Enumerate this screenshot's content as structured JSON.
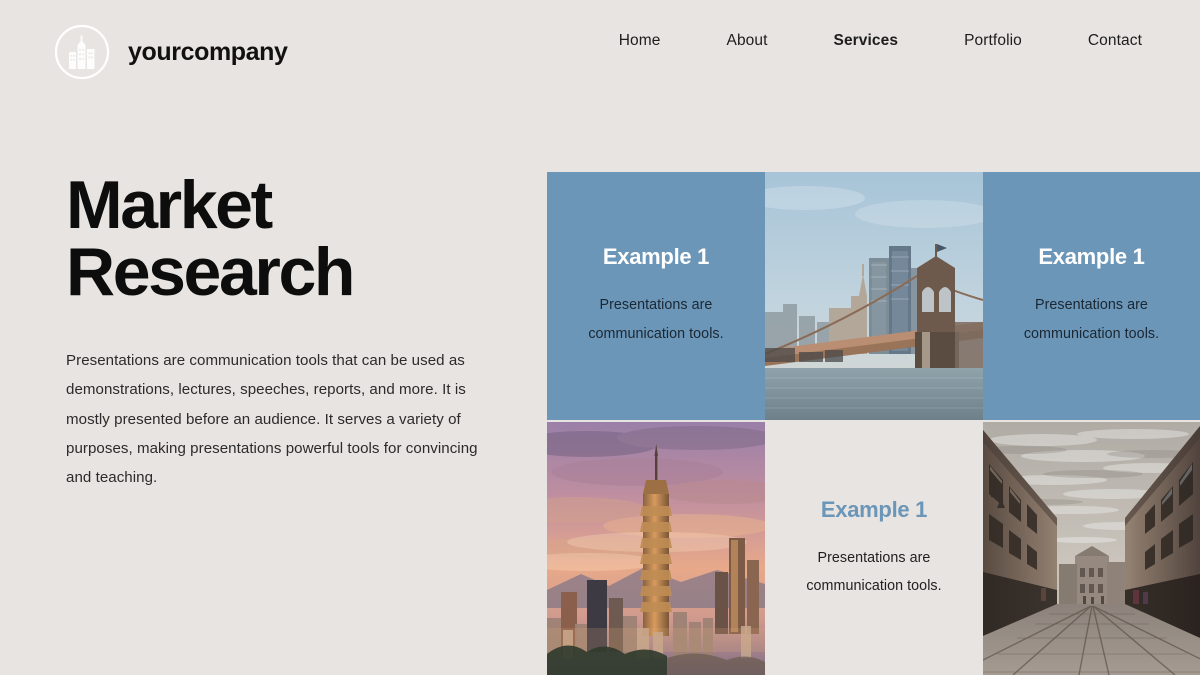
{
  "brand": {
    "name": "yourcompany",
    "logo_icon": "circle-buildings-icon"
  },
  "nav": {
    "items": [
      {
        "label": "Home",
        "active": false
      },
      {
        "label": "About",
        "active": false
      },
      {
        "label": "Services",
        "active": true
      },
      {
        "label": "Portfolio",
        "active": false
      },
      {
        "label": "Contact",
        "active": false
      }
    ]
  },
  "hero": {
    "title_line1": "Market",
    "title_line2": "Research",
    "paragraph": "Presentations are communication tools that can be used as demonstrations, lectures, speeches, reports, and more. It is mostly presented before an audience. It serves a variety of purposes, making presentations powerful tools for convincing and teaching."
  },
  "grid": {
    "cells": [
      {
        "type": "text",
        "style": "blue",
        "title": "Example 1",
        "desc": "Presentations are communication tools."
      },
      {
        "type": "photo",
        "subject": "brooklyn-bridge-nyc-skyline-photo"
      },
      {
        "type": "text",
        "style": "blue",
        "title": "Example 1",
        "desc": "Presentations are communication tools."
      },
      {
        "type": "photo",
        "subject": "taipei-101-sunset-skyline-photo"
      },
      {
        "type": "text",
        "style": "beige",
        "title": "Example 1",
        "desc": "Presentations are communication tools."
      },
      {
        "type": "photo",
        "subject": "european-cobblestone-street-photo"
      }
    ]
  },
  "colors": {
    "background": "#e8e4e1",
    "accent_blue": "#6b96b8",
    "text_dark": "#0d0d0d",
    "text_body": "#2b2b2b",
    "white": "#ffffff"
  }
}
